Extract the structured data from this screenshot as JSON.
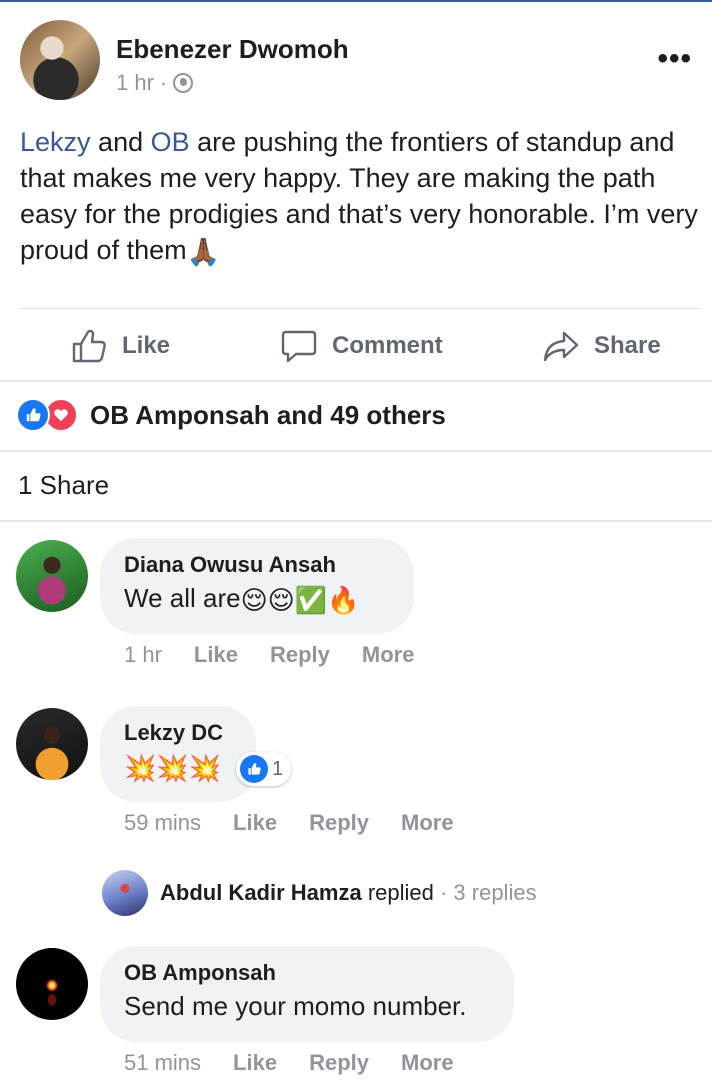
{
  "post": {
    "author": "Ebenezer Dwomoh",
    "time": "1 hr",
    "meta_sep": "·",
    "text_parts": {
      "mention1": "Lekzy",
      "t1": " and ",
      "mention2": "OB",
      "t2": " are pushing the frontiers of standup and that makes me very happy. They are making the path easy for the prodigies and that’s very honorable. I’m very proud of them",
      "emoji": "🙏🏾"
    },
    "more_icon": "•••"
  },
  "actions": {
    "like": "Like",
    "comment": "Comment",
    "share": "Share"
  },
  "reactions": {
    "summary": "OB Amponsah and 49 others"
  },
  "shares": "1 Share",
  "comments": [
    {
      "name": "Diana Owusu Ansah",
      "text": "We all are",
      "emojis": "😌😌✅🔥",
      "time": "1 hr",
      "like": "Like",
      "reply": "Reply",
      "more": "More"
    },
    {
      "name": "Lekzy DC",
      "text": "",
      "emojis": "💥💥💥",
      "reaction_count": "1",
      "time": "59 mins",
      "like": "Like",
      "reply": "Reply",
      "more": "More"
    },
    {
      "name": "OB Amponsah",
      "text": "Send me your momo number.",
      "time": "51 mins",
      "like": "Like",
      "reply": "Reply",
      "more": "More"
    }
  ],
  "reply_summary": {
    "name": "Abdul Kadir Hamza",
    "action": " replied",
    "count": " · 3 replies"
  },
  "colors": {
    "mention": "#385898",
    "like_blue": "#1877f2",
    "love_red": "#f33e58",
    "muted": "#90949c",
    "bubble": "#f0f2f5"
  }
}
